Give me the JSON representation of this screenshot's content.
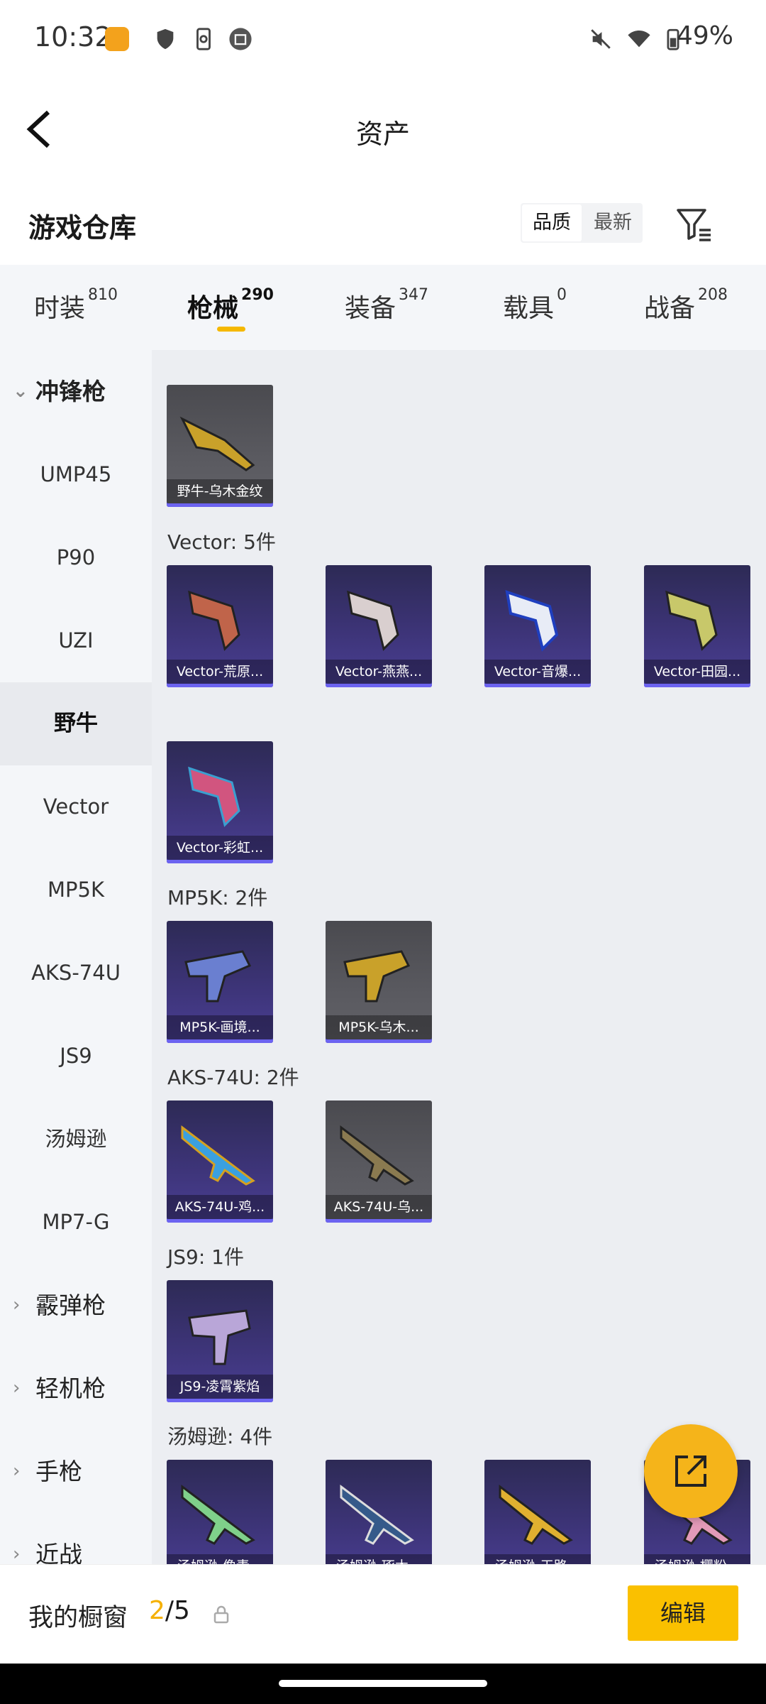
{
  "status_bar": {
    "time": "10:32",
    "battery": "49%"
  },
  "header": {
    "title": "资产"
  },
  "section": {
    "title": "游戏仓库",
    "sort_quality": "品质",
    "sort_latest": "最新"
  },
  "tabs": [
    {
      "label": "时装",
      "count": "810"
    },
    {
      "label": "枪械",
      "count": "290"
    },
    {
      "label": "装备",
      "count": "347"
    },
    {
      "label": "载具",
      "count": "0"
    },
    {
      "label": "战备",
      "count": "208"
    }
  ],
  "sidebar": {
    "groups": [
      "冲锋枪",
      "霰弹枪",
      "轻机枪",
      "手枪",
      "近战"
    ],
    "items": [
      "UMP45",
      "P90",
      "UZI",
      "野牛",
      "Vector",
      "MP5K",
      "AKS-74U",
      "JS9",
      "汤姆逊",
      "MP7-G"
    ]
  },
  "content": {
    "groups": [
      {
        "label": "",
        "cards": [
          "野牛-乌木金纹"
        ]
      },
      {
        "label": "Vector: 5件",
        "cards": [
          "Vector-荒原...",
          "Vector-燕燕...",
          "Vector-音爆...",
          "Vector-田园...",
          "Vector-彩虹..."
        ]
      },
      {
        "label": "MP5K: 2件",
        "cards": [
          "MP5K-画境...",
          "MP5K-乌木..."
        ]
      },
      {
        "label": "AKS-74U: 2件",
        "cards": [
          "AKS-74U-鸡...",
          "AKS-74U-乌..."
        ]
      },
      {
        "label": "JS9: 1件",
        "cards": [
          "JS9-凌霄紫焰"
        ]
      },
      {
        "label": "汤姆逊: 4件",
        "cards": [
          "汤姆逊-像素...",
          "汤姆逊-琢木...",
          "汤姆逊-天路...",
          "汤姆逊-樱粉..."
        ]
      }
    ]
  },
  "bottom": {
    "label": "我的橱窗",
    "count_current": "2",
    "count_sep": "/5",
    "edit_label": "编辑"
  },
  "colors": {
    "accent": "#fac000",
    "card_purple": "#3d3478",
    "indicator": "#f5b800"
  }
}
